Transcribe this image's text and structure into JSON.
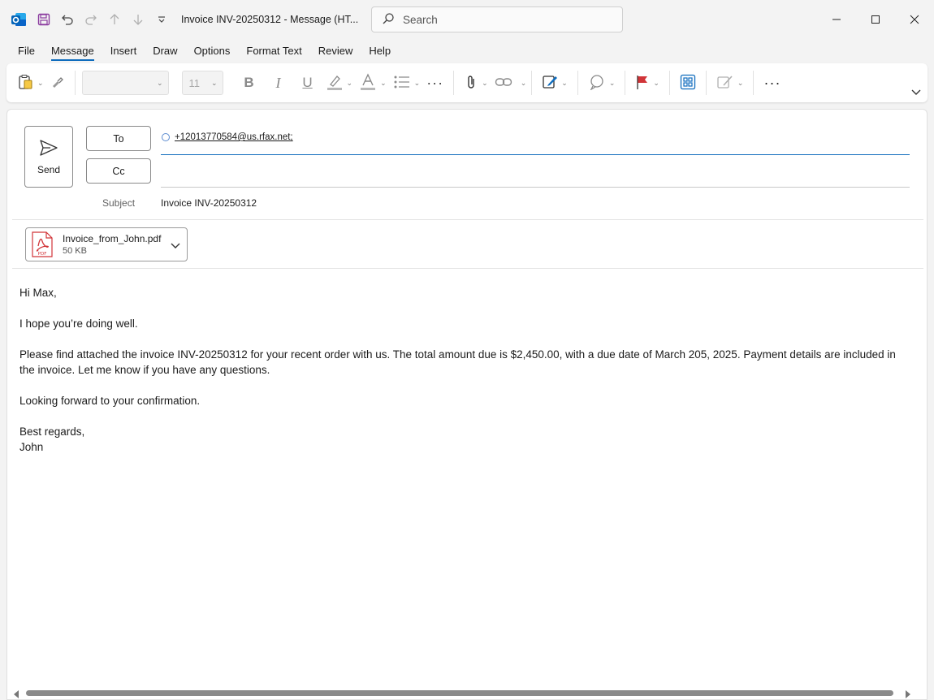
{
  "window": {
    "title": "Invoice INV-20250312  -  Message (HT...",
    "search_placeholder": "Search"
  },
  "menu": {
    "tabs": [
      {
        "label": "File"
      },
      {
        "label": "Message"
      },
      {
        "label": "Insert"
      },
      {
        "label": "Draw"
      },
      {
        "label": "Options"
      },
      {
        "label": "Format Text"
      },
      {
        "label": "Review"
      },
      {
        "label": "Help"
      }
    ],
    "active": "Message"
  },
  "ribbon": {
    "font_size": "11",
    "more_label": "···"
  },
  "compose": {
    "send_label": "Send",
    "to_label": "To",
    "cc_label": "Cc",
    "to_recipient": "+12013770584@us.rfax.net;",
    "subject_label": "Subject",
    "subject_value": "Invoice INV-20250312"
  },
  "attachment": {
    "filename": "Invoice_from_John.pdf",
    "size": "50 KB",
    "type_label": "PDF"
  },
  "body": {
    "greeting": "Hi Max,",
    "line1": "I hope you’re doing well.",
    "line2": "Please find attached the invoice INV-20250312 for your recent order with us. The total amount due is $2,450.00, with a due date of March 205, 2025. Payment details are included in the invoice. Let me know if you have any questions.",
    "line3": "Looking forward to your confirmation.",
    "closing": "Best regards,",
    "signature": "John"
  },
  "colors": {
    "accent": "#0f6cbd",
    "outlook_blue": "#0a64c8",
    "pdf_red": "#d13438",
    "save_purple": "#8a3a9e",
    "flag_red": "#d13438"
  }
}
